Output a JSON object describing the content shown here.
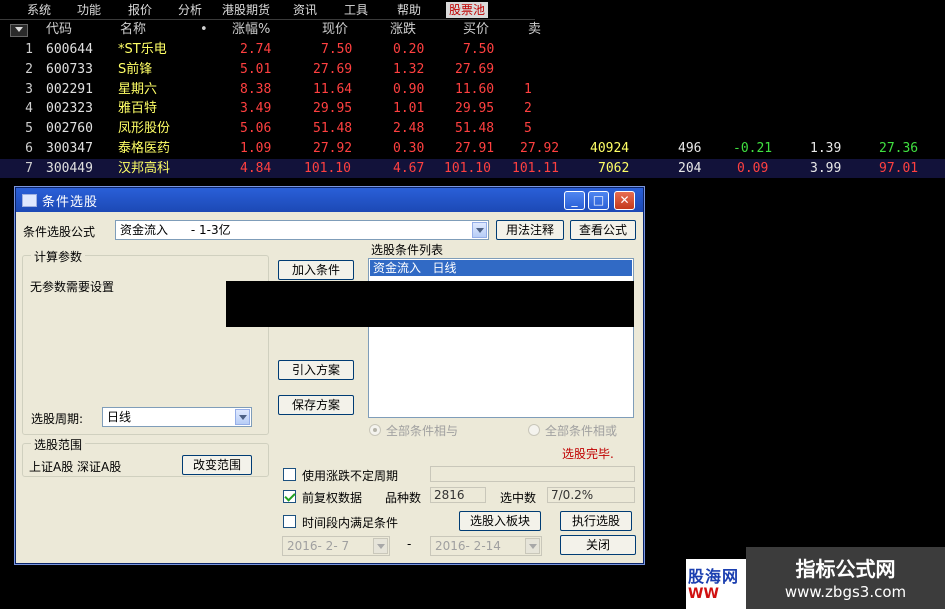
{
  "menu": [
    "系统",
    "功能",
    "报价",
    "分析",
    "港股期货",
    "资讯",
    "工具",
    "帮助",
    "股票池"
  ],
  "table": {
    "headers": [
      "代码",
      "名称",
      "•",
      "涨幅%",
      "现价",
      "涨跌",
      "买价",
      "卖"
    ],
    "rows": [
      {
        "no": "1",
        "code": "600644",
        "name": "*ST乐电",
        "chg": "2.74",
        "price": "7.50",
        "delta": "0.20",
        "bid": "7.50"
      },
      {
        "no": "2",
        "code": "600733",
        "name": "S前锋",
        "chg": "5.01",
        "price": "27.69",
        "delta": "1.32",
        "bid": "27.69"
      },
      {
        "no": "3",
        "code": "002291",
        "name": "星期六",
        "chg": "8.38",
        "price": "11.64",
        "delta": "0.90",
        "bid": "11.60",
        "ask": "1"
      },
      {
        "no": "4",
        "code": "002323",
        "name": "雅百特",
        "chg": "3.49",
        "price": "29.95",
        "delta": "1.01",
        "bid": "29.95",
        "ask": "2"
      },
      {
        "no": "5",
        "code": "002760",
        "name": "凤形股份",
        "chg": "5.06",
        "price": "51.48",
        "delta": "2.48",
        "bid": "51.48",
        "ask": "5"
      },
      {
        "no": "6",
        "code": "300347",
        "name": "泰格医药",
        "chg": "1.09",
        "price": "27.92",
        "delta": "0.30",
        "bid": "27.91",
        "ask": "27.92",
        "vol": "40924",
        "cur": "496",
        "speed": "-0.21",
        "turnover": "1.39",
        "pe": "27.36"
      },
      {
        "no": "7",
        "code": "300449",
        "name": "汉邦高科",
        "chg": "4.84",
        "price": "101.10",
        "delta": "4.67",
        "bid": "101.10",
        "ask": "101.11",
        "vol": "7062",
        "cur": "204",
        "speed": "0.09",
        "turnover": "3.99",
        "pe": "97.01"
      }
    ]
  },
  "dialog": {
    "title": "条件选股",
    "formula_label": "条件选股公式",
    "formula_value": "资金流入      - 1-3亿",
    "btn_usage": "用法注释",
    "btn_view": "查看公式",
    "calc_params_title": "计算参数",
    "no_params": "无参数需要设置",
    "btn_add": "加入条件",
    "cond_list_label": "选股条件列表",
    "cond_item": "资金流入   日线",
    "btn_import": "引入方案",
    "btn_save": "保存方案",
    "period_label": "选股周期:",
    "period_value": "日线",
    "radio_and": "全部条件相与",
    "radio_or": "全部条件相或",
    "status": "选股完毕.",
    "range_title": "选股范围",
    "range_value": "上证A股 深证A股",
    "btn_change_range": "改变范围",
    "chk_irregular": "使用涨跌不定周期",
    "chk_adjust": "前复权数据",
    "count_label": "品种数",
    "count_value": "2816",
    "selected_label": "选中数",
    "selected_value": "7/0.2%",
    "chk_period": "时间段内满足条件",
    "btn_to_block": "选股入板块",
    "btn_execute": "执行选股",
    "date_from": "2016- 2- 7",
    "date_sep": "-",
    "date_to": "2016- 2-14",
    "btn_close": "关闭"
  },
  "watermark": {
    "left_text": "股海网",
    "left_url": "WW",
    "right_title": "指标公式网",
    "right_url": "www.zbgs3.com"
  }
}
